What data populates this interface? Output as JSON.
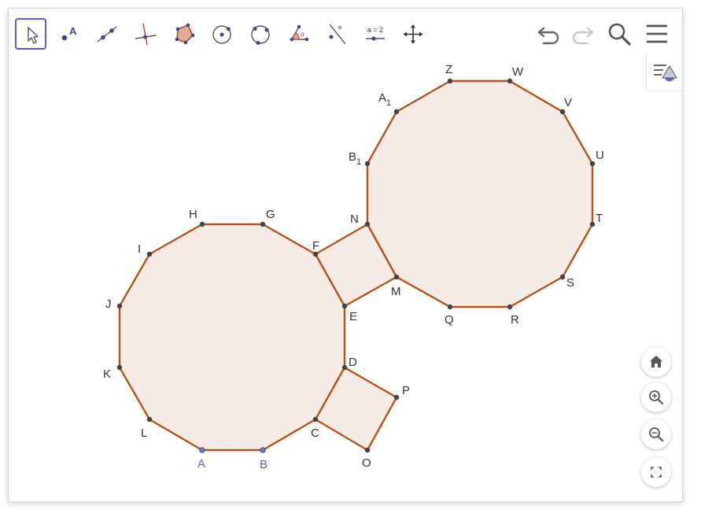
{
  "toolbar": {
    "tools": [
      {
        "id": "move",
        "icon": "arrow-pointer-icon"
      },
      {
        "id": "point",
        "icon": "point-icon"
      },
      {
        "id": "line",
        "icon": "line-icon"
      },
      {
        "id": "perpendicular",
        "icon": "perpendicular-line-icon"
      },
      {
        "id": "polygon",
        "icon": "polygon-icon"
      },
      {
        "id": "circle-center",
        "icon": "circle-center-icon"
      },
      {
        "id": "circle-three-points",
        "icon": "circle-three-points-icon"
      },
      {
        "id": "angle",
        "icon": "angle-icon"
      },
      {
        "id": "reflect",
        "icon": "reflect-line-icon"
      },
      {
        "id": "slider",
        "icon": "slider-icon",
        "label": "a = 2"
      },
      {
        "id": "move-view",
        "icon": "move-graphics-icon"
      }
    ],
    "selected_tool": "move",
    "controls": [
      "undo-icon",
      "redo-icon",
      "search-icon",
      "menu-icon"
    ]
  },
  "labels": {
    "A": "A",
    "B": "B",
    "C": "C",
    "D": "D",
    "E": "E",
    "F": "F",
    "G": "G",
    "H": "H",
    "I": "I",
    "J": "J",
    "K": "K",
    "L": "L",
    "M": "M",
    "N": "N",
    "O": "O",
    "P": "P",
    "Q": "Q",
    "R": "R",
    "S": "S",
    "T": "T",
    "U": "U",
    "V": "V",
    "W": "W",
    "Z": "Z",
    "A1_main": "A",
    "A1_sub": "1",
    "B1_main": "B",
    "B1_sub": "1"
  },
  "colors": {
    "accent": "#6557d2",
    "polygon_stroke": "#b5541a",
    "polygon_fill": "#f7ebe8",
    "point": "#444444",
    "free_point": "#6b7bb5",
    "free_label": "#4f63b6"
  },
  "view_controls": [
    "home-icon",
    "zoom-in-icon",
    "zoom-out-icon",
    "fullscreen-icon"
  ]
}
